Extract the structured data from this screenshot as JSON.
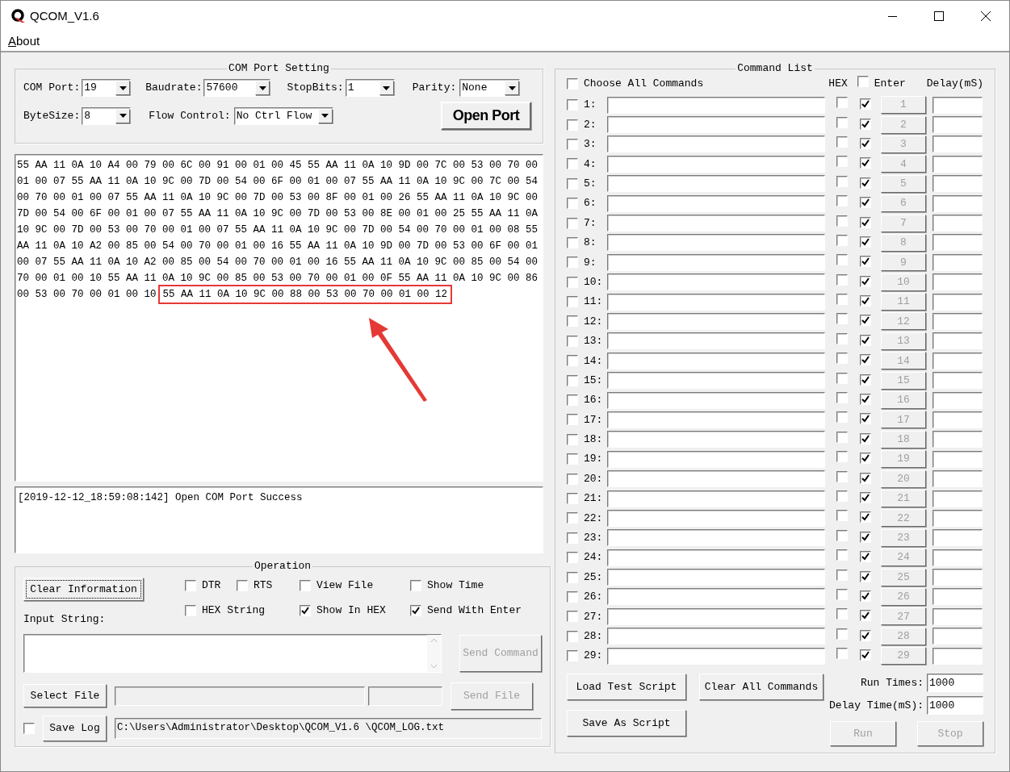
{
  "window": {
    "title": "QCOM_V1.6"
  },
  "menu": [
    {
      "label": "About"
    }
  ],
  "com_port_setting": {
    "title": "COM Port Setting",
    "fields": [
      {
        "label": "COM Port:",
        "value": "19"
      },
      {
        "label": "Baudrate:",
        "value": "57600"
      },
      {
        "label": "StopBits:",
        "value": "1"
      },
      {
        "label": "Parity:",
        "value": "None"
      },
      {
        "label": "ByteSize:",
        "value": "8"
      },
      {
        "label": "Flow Control:",
        "value": "No Ctrl Flow"
      }
    ],
    "open_button": "Open Port"
  },
  "receive_view": {
    "lines": [
      {
        "text": "55 AA 11 0A 10 A4 00 79 00 6C 00 91 00 01 00 45 55 AA 11 0A 10 9D 00 7C 00 53 00 70 00"
      },
      {
        "text": "01 00 07 55 AA 11 0A 10 9C 00 7D 00 54 00 6F 00 01 00 07 55 AA 11 0A 10 9C 00 7C 00 54"
      },
      {
        "text": "00 70 00 01 00 07 55 AA 11 0A 10 9C 00 7D 00 53 00 8F 00 01 00 26 55 AA 11 0A 10 9C 00"
      },
      {
        "text": "7D 00 54 00 6F 00 01 00 07 55 AA 11 0A 10 9C 00 7D 00 53 00 8E 00 01 00 25 55 AA 11 0A"
      },
      {
        "text": "10 9C 00 7D 00 53 00 70 00 01 00 07 55 AA 11 0A 10 9C 00 7D 00 54 00 70 00 01 00 08 55"
      },
      {
        "text": "AA 11 0A 10 A2 00 85 00 54 00 70 00 01 00 16 55 AA 11 0A 10 9D 00 7D 00 53 00 6F 00 01"
      },
      {
        "text": "00 07 55 AA 11 0A 10 A2 00 85 00 54 00 70 00 01 00 16 55 AA 11 0A 10 9C 00 85 00 54 00"
      },
      {
        "text": "70 00 01 00 10 55 AA 11 0A 10 9C 00 85 00 53 00 70 00 01 00 0F 55 AA 11 0A 10 9C 00 86"
      },
      {
        "text": "00 53 00 70 00 01 00 10",
        "highlight": "55 AA 11 0A 10 9C 00 88 00 53 00 70 00 01 00 12"
      }
    ]
  },
  "log": {
    "lines": [
      "[2019-12-12_18:59:08:142] Open COM Port Success"
    ]
  },
  "operation": {
    "title": "Operation",
    "clear_button": "Clear Information",
    "options": [
      {
        "label": "DTR",
        "checked": false
      },
      {
        "label": "RTS",
        "checked": false
      },
      {
        "label": "View File",
        "checked": false
      },
      {
        "label": "Show Time",
        "checked": false
      },
      {
        "label": "HEX String",
        "checked": false
      },
      {
        "label": "Show In HEX",
        "checked": true
      },
      {
        "label": "Send With Enter",
        "checked": true
      }
    ],
    "input_label": "Input String:",
    "send_command": {
      "label": "Send Command",
      "disabled": true
    },
    "select_file": {
      "label": "Select File",
      "disabled": false
    },
    "send_file": {
      "label": "Send File",
      "disabled": true
    },
    "save_log": {
      "label": "Save Log",
      "checked": false
    },
    "log_path": "C:\\Users\\Administrator\\Desktop\\QCOM_V1.6 \\QCOM_LOG.txt"
  },
  "command_list": {
    "title": "Command List",
    "choose_all": {
      "label": "Choose All Commands",
      "checked": false
    },
    "hex_header": "HEX",
    "enter_header": {
      "label": "Enter",
      "checked": false
    },
    "delay_header": "Delay(mS)",
    "rows": [
      {
        "checked": false,
        "label": "1:",
        "hex": false,
        "enter": true,
        "button": "1",
        "disabled": true
      },
      {
        "checked": false,
        "label": "2:",
        "hex": false,
        "enter": true,
        "button": "2",
        "disabled": true
      },
      {
        "checked": false,
        "label": "3:",
        "hex": false,
        "enter": true,
        "button": "3",
        "disabled": true
      },
      {
        "checked": false,
        "label": "4:",
        "hex": false,
        "enter": true,
        "button": "4",
        "disabled": true
      },
      {
        "checked": false,
        "label": "5:",
        "hex": false,
        "enter": true,
        "button": "5",
        "disabled": true
      },
      {
        "checked": false,
        "label": "6:",
        "hex": false,
        "enter": true,
        "button": "6",
        "disabled": true
      },
      {
        "checked": false,
        "label": "7:",
        "hex": false,
        "enter": true,
        "button": "7",
        "disabled": true
      },
      {
        "checked": false,
        "label": "8:",
        "hex": false,
        "enter": true,
        "button": "8",
        "disabled": true
      },
      {
        "checked": false,
        "label": "9:",
        "hex": false,
        "enter": true,
        "button": "9",
        "disabled": true
      },
      {
        "checked": false,
        "label": "10:",
        "hex": false,
        "enter": true,
        "button": "10",
        "disabled": true
      },
      {
        "checked": false,
        "label": "11:",
        "hex": false,
        "enter": true,
        "button": "11",
        "disabled": true
      },
      {
        "checked": false,
        "label": "12:",
        "hex": false,
        "enter": true,
        "button": "12",
        "disabled": true
      },
      {
        "checked": false,
        "label": "13:",
        "hex": false,
        "enter": true,
        "button": "13",
        "disabled": true
      },
      {
        "checked": false,
        "label": "14:",
        "hex": false,
        "enter": true,
        "button": "14",
        "disabled": true
      },
      {
        "checked": false,
        "label": "15:",
        "hex": false,
        "enter": true,
        "button": "15",
        "disabled": true
      },
      {
        "checked": false,
        "label": "16:",
        "hex": false,
        "enter": true,
        "button": "16",
        "disabled": true
      },
      {
        "checked": false,
        "label": "17:",
        "hex": false,
        "enter": true,
        "button": "17",
        "disabled": true
      },
      {
        "checked": false,
        "label": "18:",
        "hex": false,
        "enter": true,
        "button": "18",
        "disabled": true
      },
      {
        "checked": false,
        "label": "19:",
        "hex": false,
        "enter": true,
        "button": "19",
        "disabled": true
      },
      {
        "checked": false,
        "label": "20:",
        "hex": false,
        "enter": true,
        "button": "20",
        "disabled": true
      },
      {
        "checked": false,
        "label": "21:",
        "hex": false,
        "enter": true,
        "button": "21",
        "disabled": true
      },
      {
        "checked": false,
        "label": "22:",
        "hex": false,
        "enter": true,
        "button": "22",
        "disabled": true
      },
      {
        "checked": false,
        "label": "23:",
        "hex": false,
        "enter": true,
        "button": "23",
        "disabled": true
      },
      {
        "checked": false,
        "label": "24:",
        "hex": false,
        "enter": true,
        "button": "24",
        "disabled": true
      },
      {
        "checked": false,
        "label": "25:",
        "hex": false,
        "enter": true,
        "button": "25",
        "disabled": true
      },
      {
        "checked": false,
        "label": "26:",
        "hex": false,
        "enter": true,
        "button": "26",
        "disabled": true
      },
      {
        "checked": false,
        "label": "27:",
        "hex": false,
        "enter": true,
        "button": "27",
        "disabled": true
      },
      {
        "checked": false,
        "label": "28:",
        "hex": false,
        "enter": true,
        "button": "28",
        "disabled": true
      },
      {
        "checked": false,
        "label": "29:",
        "hex": false,
        "enter": true,
        "button": "29",
        "disabled": true
      }
    ],
    "load_button": "Load Test Script",
    "clear_button": "Clear All Commands",
    "save_button": "Save As Script",
    "run_times": {
      "label": "Run Times:",
      "value": "1000"
    },
    "delay_time": {
      "label": "Delay Time(mS):",
      "value": "1000"
    },
    "run": {
      "label": "Run",
      "disabled": true
    },
    "stop": {
      "label": "Stop",
      "disabled": true
    }
  }
}
